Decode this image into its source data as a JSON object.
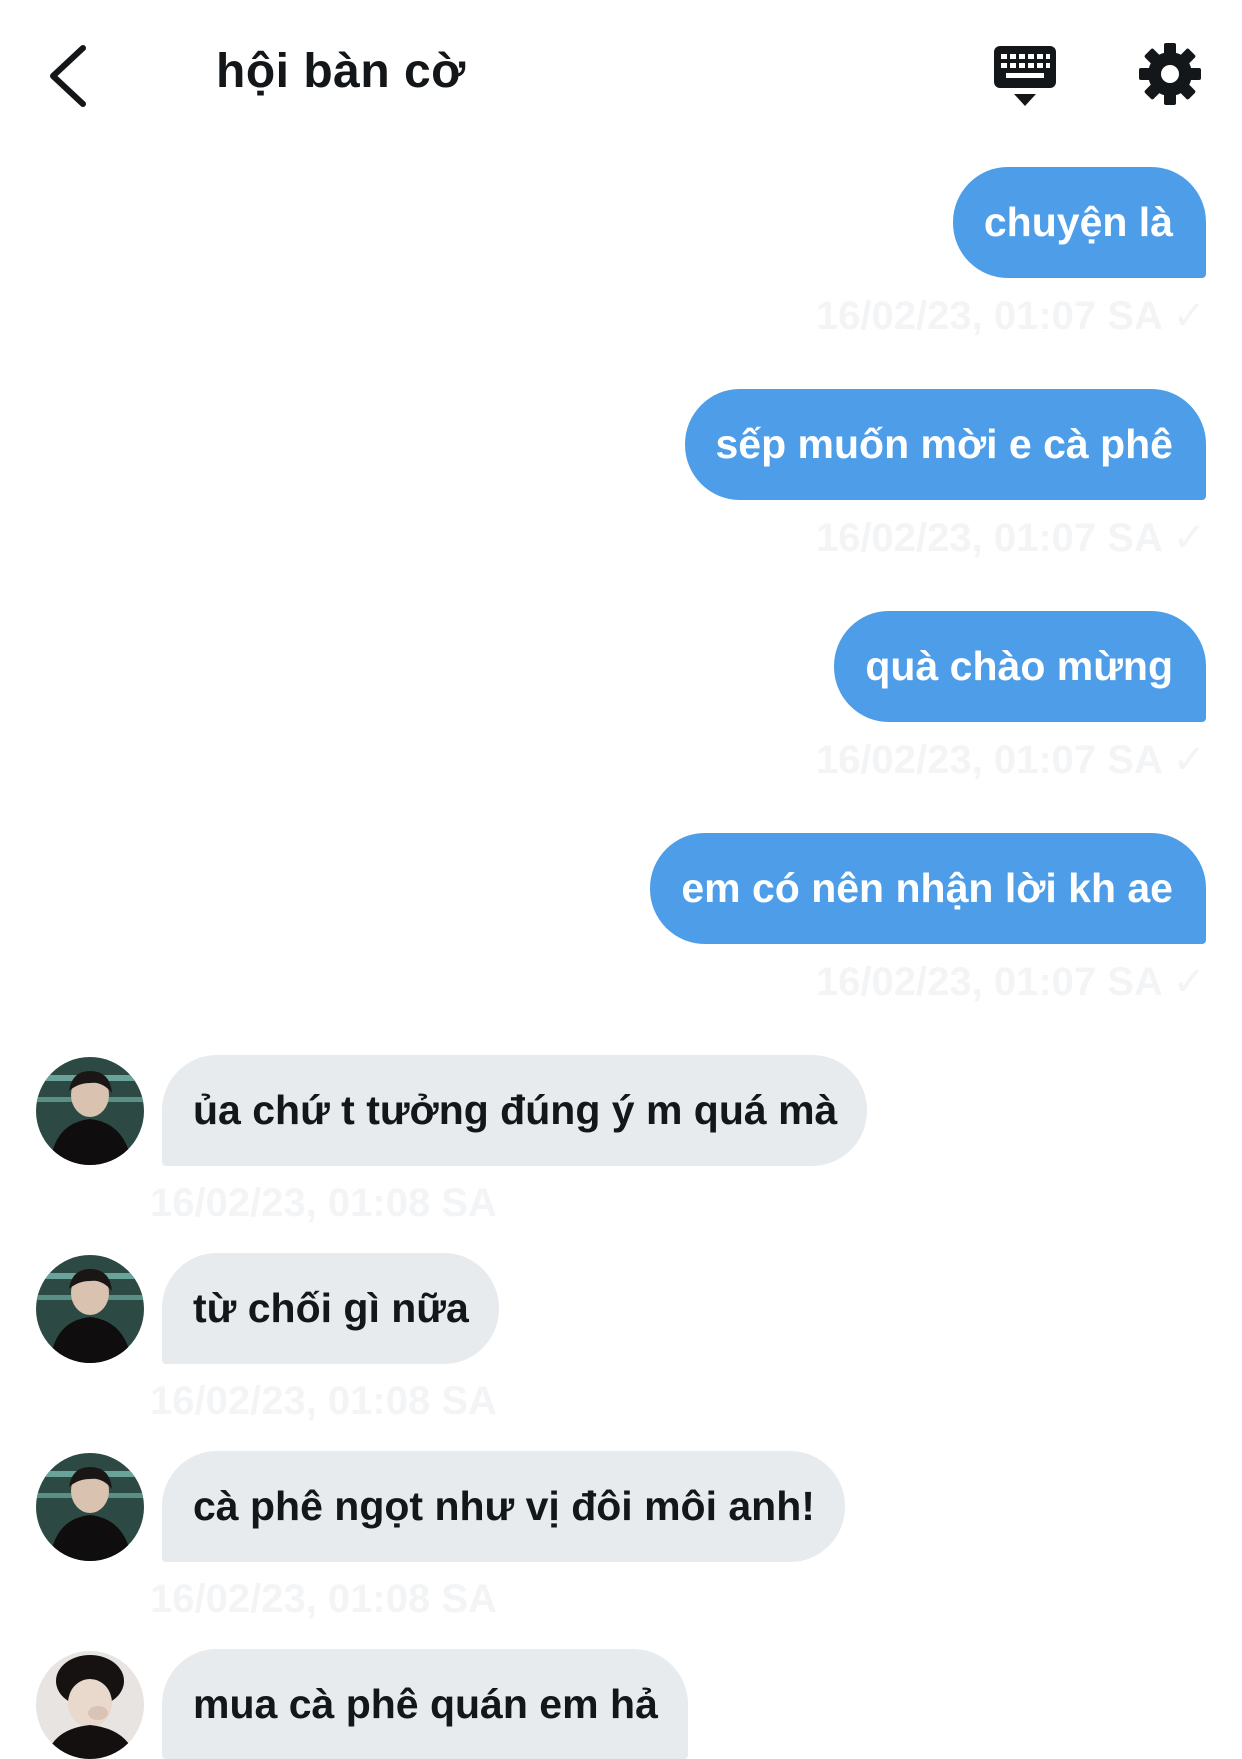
{
  "header": {
    "title": "hội bàn cờ",
    "back_icon": "chevron-left-icon",
    "keyboard_icon": "keyboard-icon",
    "settings_icon": "gear-icon"
  },
  "messages": [
    {
      "direction": "out",
      "text": "chuyện là",
      "meta": "16/02/23, 01:07 SA ✓"
    },
    {
      "direction": "out",
      "text": "sếp muốn mời e cà phê",
      "meta": "16/02/23, 01:07 SA ✓"
    },
    {
      "direction": "out",
      "text": "quà chào mừng",
      "meta": "16/02/23, 01:07 SA ✓"
    },
    {
      "direction": "out",
      "text": "em có nên nhận lời kh ae",
      "meta": "16/02/23, 01:07 SA ✓"
    },
    {
      "direction": "in",
      "text": "ủa chứ t tưởng đúng ý m quá mà",
      "meta": "16/02/23, 01:08 SA"
    },
    {
      "direction": "in",
      "text": "từ chối gì nữa",
      "meta": "16/02/23, 01:08 SA"
    },
    {
      "direction": "in",
      "text": "cà phê ngọt như vị đôi môi anh!",
      "meta": "16/02/23, 01:08 SA"
    },
    {
      "direction": "in",
      "text": "mua cà phê quán em hả",
      "meta": ""
    }
  ],
  "colors": {
    "outgoing_bubble": "#4d9de9",
    "incoming_bubble": "#e8ebee",
    "text_primary": "#14171a"
  }
}
